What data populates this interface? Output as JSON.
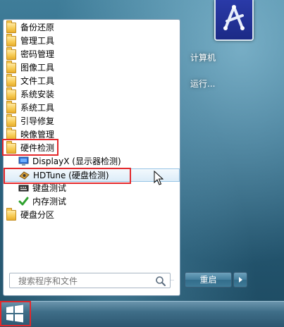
{
  "menu": {
    "items": [
      {
        "label": "备份还原",
        "type": "folder"
      },
      {
        "label": "管理工具",
        "type": "folder"
      },
      {
        "label": "密码管理",
        "type": "folder"
      },
      {
        "label": "图像工具",
        "type": "folder"
      },
      {
        "label": "文件工具",
        "type": "folder"
      },
      {
        "label": "系统安装",
        "type": "folder"
      },
      {
        "label": "系统工具",
        "type": "folder"
      },
      {
        "label": "引导修复",
        "type": "folder"
      },
      {
        "label": "映像管理",
        "type": "folder"
      },
      {
        "label": "硬件检测",
        "type": "folder",
        "open": true
      },
      {
        "label": "DisplayX (显示器检测)",
        "type": "app",
        "icon": "monitor-icon"
      },
      {
        "label": "HDTune (硬盘检测)",
        "type": "app",
        "icon": "hdtune-icon"
      },
      {
        "label": "键盘测试",
        "type": "app",
        "icon": "keyboard-icon"
      },
      {
        "label": "内存测试",
        "type": "app",
        "icon": "memory-check-icon"
      },
      {
        "label": "硬盘分区",
        "type": "folder"
      }
    ]
  },
  "search": {
    "placeholder": "搜索程序和文件"
  },
  "right": {
    "computer": "计算机",
    "run": "运行..."
  },
  "restart": {
    "label": "重启"
  },
  "colors": {
    "highlight": "#e3282b",
    "hover_border": "#98c5e6"
  }
}
